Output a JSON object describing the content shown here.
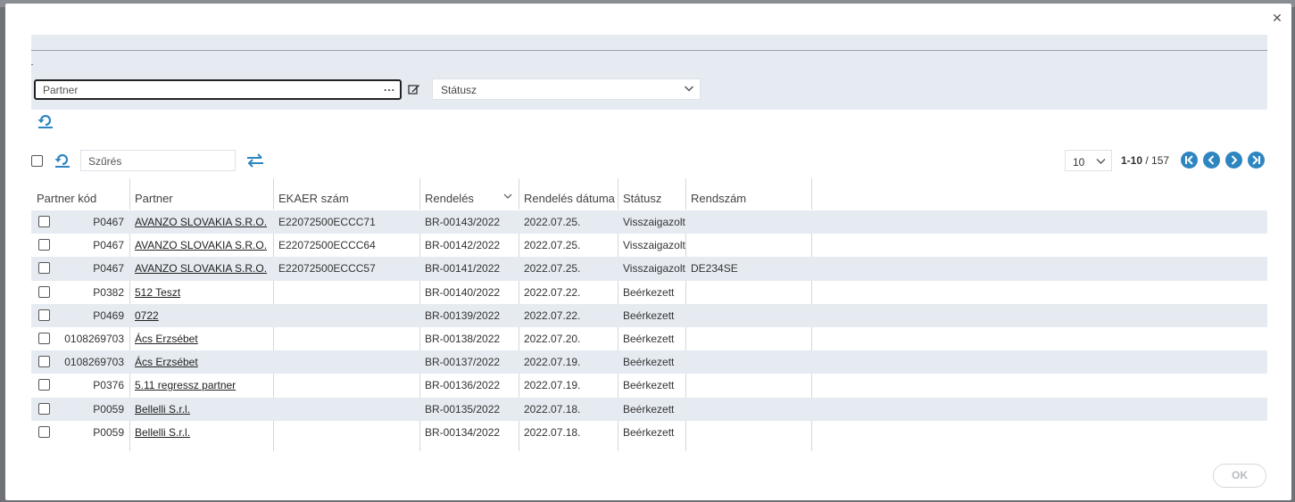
{
  "filter": {
    "partner_placeholder": "Partner",
    "partner_dots": "...",
    "status_placeholder": "Státusz"
  },
  "toolbar": {
    "search_placeholder": "Szűrés",
    "page_size": "10",
    "range": "1-10",
    "total": "157"
  },
  "columns": [
    "Partner kód",
    "Partner",
    "EKAER szám",
    "Rendelés",
    "Rendelés dátuma",
    "Státusz",
    "Rendszám"
  ],
  "rows": [
    {
      "code": "P0467",
      "partner": "AVANZO SLOVAKIA S.R.O.",
      "ekaer": "E22072500ECCC71",
      "order": "BR-00143/2022",
      "date": "2022.07.25.",
      "status": "Visszaigazolt",
      "plate": ""
    },
    {
      "code": "P0467",
      "partner": "AVANZO SLOVAKIA S.R.O.",
      "ekaer": "E22072500ECCC64",
      "order": "BR-00142/2022",
      "date": "2022.07.25.",
      "status": "Visszaigazolt",
      "plate": ""
    },
    {
      "code": "P0467",
      "partner": "AVANZO SLOVAKIA S.R.O.",
      "ekaer": "E22072500ECCC57",
      "order": "BR-00141/2022",
      "date": "2022.07.25.",
      "status": "Visszaigazolt",
      "plate": "DE234SE"
    },
    {
      "code": "P0382",
      "partner": "512 Teszt",
      "ekaer": "",
      "order": "BR-00140/2022",
      "date": "2022.07.22.",
      "status": "Beérkezett",
      "plate": ""
    },
    {
      "code": "P0469",
      "partner": "0722",
      "ekaer": "",
      "order": "BR-00139/2022",
      "date": "2022.07.22.",
      "status": "Beérkezett",
      "plate": ""
    },
    {
      "code": "0108269703",
      "partner": "Ács Erzsébet",
      "ekaer": "",
      "order": "BR-00138/2022",
      "date": "2022.07.20.",
      "status": "Beérkezett",
      "plate": ""
    },
    {
      "code": "0108269703",
      "partner": "Ács Erzsébet",
      "ekaer": "",
      "order": "BR-00137/2022",
      "date": "2022.07.19.",
      "status": "Beérkezett",
      "plate": ""
    },
    {
      "code": "P0376",
      "partner": "5.11 regressz partner",
      "ekaer": "",
      "order": "BR-00136/2022",
      "date": "2022.07.19.",
      "status": "Beérkezett",
      "plate": ""
    },
    {
      "code": "P0059",
      "partner": "Bellelli S.r.l.",
      "ekaer": "",
      "order": "BR-00135/2022",
      "date": "2022.07.18.",
      "status": "Beérkezett",
      "plate": ""
    },
    {
      "code": "P0059",
      "partner": "Bellelli S.r.l.",
      "ekaer": "",
      "order": "BR-00134/2022",
      "date": "2022.07.18.",
      "status": "Beérkezett",
      "plate": ""
    }
  ],
  "footer": {
    "ok_label": "OK"
  },
  "icons": {
    "close": "close-icon",
    "edit": "edit-icon",
    "refresh": "refresh-icon",
    "swap": "swap-icon",
    "first": "first-page-icon",
    "prev": "prev-page-icon",
    "next": "next-page-icon",
    "last": "last-page-icon"
  },
  "colors": {
    "accent": "#2e86c1",
    "panel": "#e6ebf1"
  }
}
